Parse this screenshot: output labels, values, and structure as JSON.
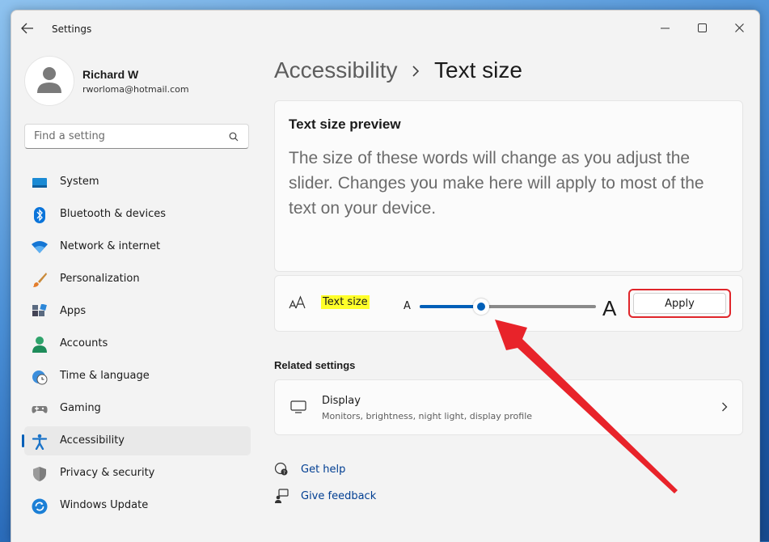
{
  "window": {
    "app_title": "Settings"
  },
  "user": {
    "name": "Richard W",
    "email": "rworloma@hotmail.com"
  },
  "search": {
    "placeholder": "Find a setting",
    "value": ""
  },
  "sidebar": {
    "items": [
      {
        "label": "System",
        "icon": "system-icon"
      },
      {
        "label": "Bluetooth & devices",
        "icon": "bluetooth-icon"
      },
      {
        "label": "Network & internet",
        "icon": "wifi-icon"
      },
      {
        "label": "Personalization",
        "icon": "brush-icon"
      },
      {
        "label": "Apps",
        "icon": "apps-icon"
      },
      {
        "label": "Accounts",
        "icon": "accounts-icon"
      },
      {
        "label": "Time & language",
        "icon": "clock-globe-icon"
      },
      {
        "label": "Gaming",
        "icon": "gamepad-icon"
      },
      {
        "label": "Accessibility",
        "icon": "accessibility-icon",
        "active": true
      },
      {
        "label": "Privacy & security",
        "icon": "shield-icon"
      },
      {
        "label": "Windows Update",
        "icon": "update-icon"
      }
    ]
  },
  "breadcrumb": {
    "parent": "Accessibility",
    "current": "Text size"
  },
  "preview": {
    "title": "Text size preview",
    "text": "The size of these words will change as you adjust the slider. Changes you make here will apply to most of the text on your device."
  },
  "text_size": {
    "label": "Text size",
    "min_glyph": "A",
    "max_glyph": "A",
    "slider_fraction": 0.35,
    "apply_label": "Apply"
  },
  "related": {
    "heading": "Related settings",
    "display_title": "Display",
    "display_subtitle": "Monitors, brightness, night light, display profile"
  },
  "links": {
    "get_help": "Get help",
    "give_feedback": "Give feedback"
  },
  "colors": {
    "accent": "#005fb8",
    "highlight": "#ffff2a",
    "annotation": "#e0262b"
  }
}
